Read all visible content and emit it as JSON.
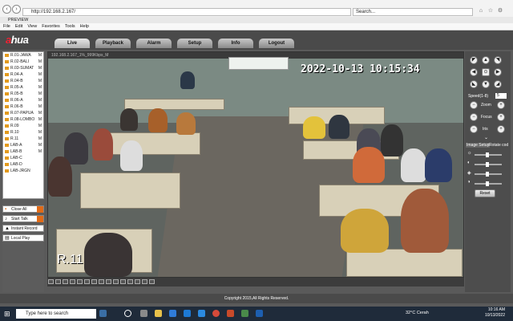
{
  "browser": {
    "url": "http://192.168.2.167/",
    "search_placeholder": "Search...",
    "tab_title": "PREVIEW",
    "menu": [
      "File",
      "Edit",
      "View",
      "Favorites",
      "Tools",
      "Help"
    ]
  },
  "app": {
    "logo_a": "a",
    "logo_rest": "hua",
    "tabs": [
      "Live",
      "Playback",
      "Alarm",
      "Setup",
      "Info",
      "Logout"
    ],
    "active_tab": "Live"
  },
  "cameras": [
    {
      "label": "R.01-JAWA",
      "mark": "M"
    },
    {
      "label": "R.02-BALI",
      "mark": "M"
    },
    {
      "label": "R.03-SUMAT",
      "mark": "M"
    },
    {
      "label": "R.04-A",
      "mark": "M"
    },
    {
      "label": "R.04-B",
      "mark": "M"
    },
    {
      "label": "R.05-A",
      "mark": "M"
    },
    {
      "label": "R.05-B",
      "mark": "M"
    },
    {
      "label": "R.06-A",
      "mark": "M"
    },
    {
      "label": "R.06-B",
      "mark": "M"
    },
    {
      "label": "R.07-PAPUA",
      "mark": "M"
    },
    {
      "label": "R.08-LOMBO",
      "mark": "M"
    },
    {
      "label": "R.09",
      "mark": "M"
    },
    {
      "label": "R.10",
      "mark": "M"
    },
    {
      "label": "R.11",
      "mark": "M"
    },
    {
      "label": "LAB-A",
      "mark": "M"
    },
    {
      "label": "LAB-B",
      "mark": "M"
    },
    {
      "label": "LAB-C",
      "mark": ""
    },
    {
      "label": "LAB-D",
      "mark": ""
    },
    {
      "label": "LAB-JRGN",
      "mark": ""
    }
  ],
  "left_buttons": {
    "close_all": "Close All",
    "start_talk": "Start Talk",
    "instant_record": "Instant Record",
    "local_play": "Local Play"
  },
  "video": {
    "info": "192.168.2.167_1%_999Kbps_M",
    "timestamp": "2022-10-13 10:15:34",
    "camera_label": "R.11"
  },
  "ptz": {
    "speed_label": "Speed(1-8)",
    "speed_value": "5",
    "zoom": "Zoom",
    "focus": "Focus",
    "iris": "Iris",
    "image_setup": "Image Setup",
    "rotate_tab": "Rotate cod",
    "reset": "Reset"
  },
  "footer": {
    "copyright": "Copyright 2015,All Rights Reserved."
  },
  "taskbar": {
    "search_placeholder": "Type here to search",
    "weather": "32°C Cerah",
    "time": "10:16 AM",
    "date": "10/13/2022"
  }
}
